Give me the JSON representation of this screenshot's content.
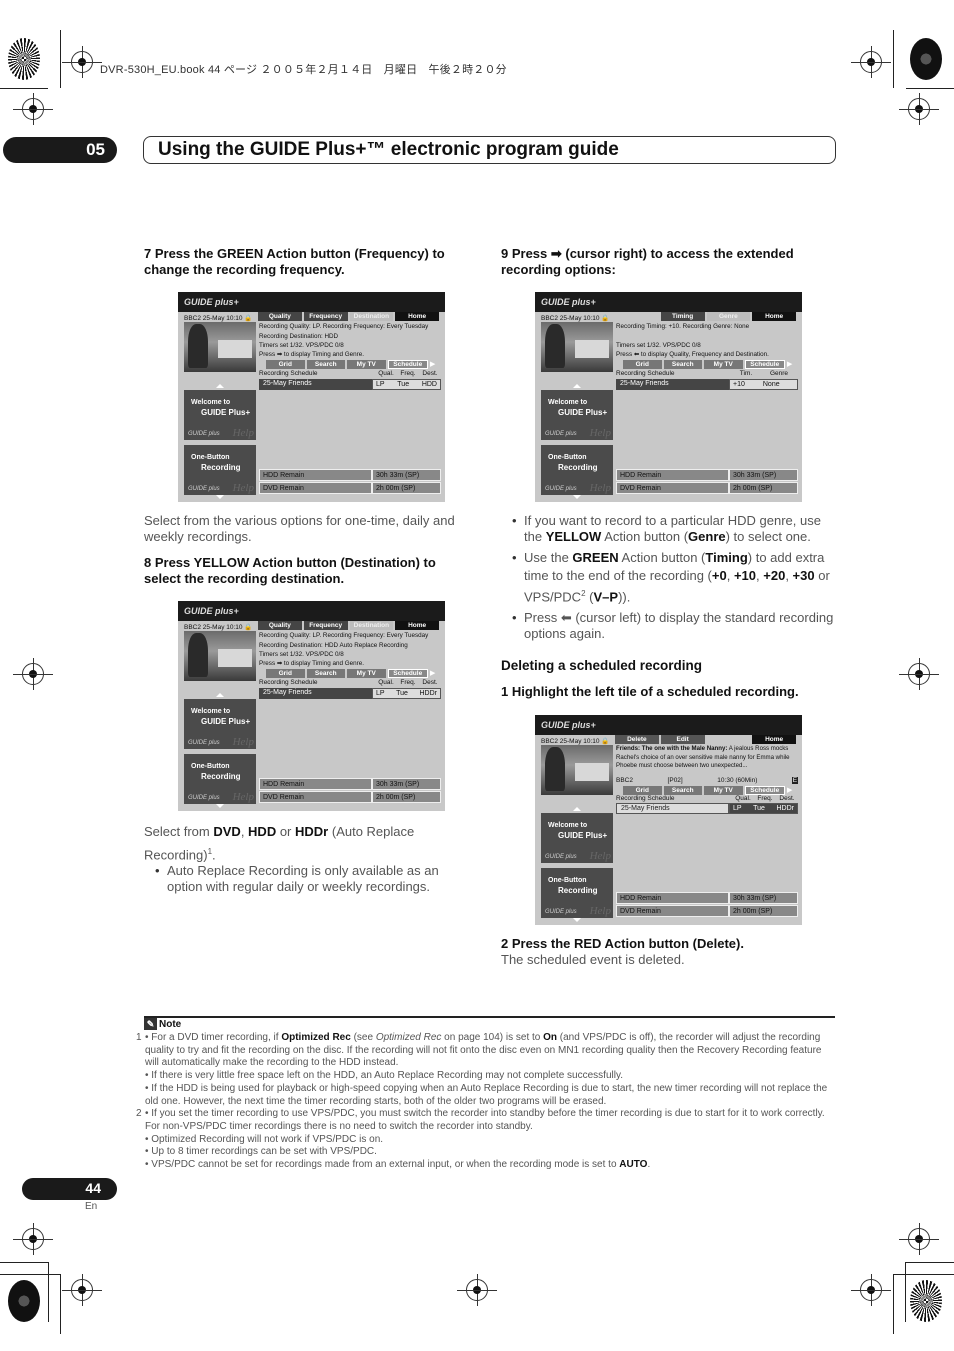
{
  "file_header": "DVR-530H_EU.book  44 ページ  ２００５年２月１４日　月曜日　午後２時２０分",
  "chapter": {
    "number": "05",
    "title": "Using the GUIDE Plus+™ electronic program guide"
  },
  "left_column": {
    "step7": "7    Press the GREEN Action button (Frequency) to change the recording frequency.",
    "step7_text": "Select from the various options for one-time, daily and weekly recordings.",
    "step8": "8    Press YELLOW Action button (Destination) to select the recording destination.",
    "step8_text": {
      "prefix": "Select from ",
      "opt1": "DVD",
      "sep1": ", ",
      "opt2": "HDD",
      "sep2": " or ",
      "opt3": "HDDr",
      "suffix": " (Auto Replace Recording)",
      "footnote_ref": "1",
      "end": "."
    },
    "step8_bullets": [
      "Auto Replace Recording is only available as an option with regular daily or weekly recordings."
    ]
  },
  "right_column": {
    "step9": "9    Press ➡ (cursor right) to access the extended recording options:",
    "bullets": [
      {
        "a": "If you want to record to a particular HDD genre, use the ",
        "b1": "YELLOW",
        "c": " Action button (",
        "b2": "Genre",
        "d": ") to select one."
      },
      {
        "a": "Use the ",
        "b1": "GREEN",
        "c": " Action button (",
        "b2": "Timing",
        "d": ") to add extra time to the end of the recording (",
        "v1": "+0",
        "v2": "+10",
        "v3": "+20",
        "v4": "+30",
        "e": " or VPS/PDC",
        "sup": "2",
        "f": " (",
        "v5": "V–P",
        "g": "))."
      },
      {
        "a": "Press ⬅ (cursor left) to display the standard recording options again."
      }
    ],
    "section_title": "Deleting a scheduled recording",
    "step1": "1    Highlight the left tile of a scheduled recording.",
    "step2": "2    Press the RED Action button (Delete).",
    "step2_text": "The scheduled event is deleted."
  },
  "screens": {
    "common": {
      "logo": "GUIDE plus+",
      "channel_info": "BBC2   25-May  10:10  🔒",
      "nav": [
        "Grid",
        "Search",
        "My TV",
        "Schedule"
      ],
      "schedule_label": "Recording Schedule",
      "schedule_title": "25-May  Friends",
      "tile1_line1": "Welcome to",
      "tile1_line2": "GUIDE Plus+",
      "tile2_line1": "One-Button",
      "tile2_line2": "Recording",
      "tile_mini_logo": "GUIDE plus",
      "tile_help": "Help",
      "hdd_remain_label": "HDD Remain",
      "hdd_remain_value": "30h 33m (SP)",
      "dvd_remain_label": "DVD Remain",
      "dvd_remain_value": "2h 00m (SP)"
    },
    "screen1": {
      "tabs": [
        "Quality",
        "Frequency",
        "Destination",
        "Home"
      ],
      "info": [
        "Recording Quality: LP. Recording Frequency: Every Tuesday",
        "Recording Destination: HDD",
        "Timers set 1/32. VPS/PDC 0/8",
        "Press ➡ to display Timing and Genre."
      ],
      "cols": [
        "Qual.",
        "Freq.",
        "Dest."
      ],
      "vals": [
        "LP",
        "Tue",
        "HDD"
      ]
    },
    "screen2": {
      "tabs": [
        "Quality",
        "Frequency",
        "Destination",
        "Home"
      ],
      "info": [
        "Recording Quality: LP. Recording Frequency: Every Tuesday",
        "Recording Destination: HDD Auto Replace Recording",
        "Timers set 1/32. VPS/PDC 0/8",
        "Press ➡ to display Timing and Genre."
      ],
      "cols": [
        "Qual.",
        "Freq.",
        "Dest."
      ],
      "vals": [
        "LP",
        "Tue",
        "HDDr"
      ]
    },
    "screen3": {
      "tabs": [
        "Timing",
        "Genre",
        "Home"
      ],
      "info": [
        "Recording Timing: +10. Recording Genre: None",
        "",
        "Timers set 1/32. VPS/PDC 0/8",
        "Press ⬅ to display Quality, Frequency and Destination."
      ],
      "cols": [
        "Tim.",
        "Genre"
      ],
      "vals": [
        "+10",
        "None"
      ]
    },
    "screen4": {
      "tabs": [
        "Delete",
        "Edit",
        "Home"
      ],
      "info_bold": "Friends: The one with the Male Nanny:",
      "info": " A jealous Ross mocks Rachel's choice of an over sensitive male nanny for Emma while Phoebe must choose between two unexpected...",
      "ext": [
        "BBC2",
        "[P02]",
        "10:30 (60Min)",
        "E"
      ],
      "cols": [
        "Qual.",
        "Freq.",
        "Dest."
      ],
      "vals": [
        "LP",
        "Tue",
        "HDDr"
      ]
    }
  },
  "note": {
    "heading": "Note",
    "fn1": {
      "num": "1",
      "p1": {
        "a": "• For a DVD timer recording, if ",
        "b": "Optimized Rec",
        "c": " (see ",
        "i": "Optimized Rec",
        "d": " on page 104) is set to ",
        "b2": "On",
        "e": " (and VPS/PDC is off), the recorder will adjust the recording quality to try and fit the recording on the disc. If the recording will not fit onto the disc even on MN1 recording quality then the Recovery Recording feature will automatically make the recording to the HDD instead."
      },
      "p2": "• If there is very little free space left on the HDD, an Auto Replace Recording may not complete successfully.",
      "p3": "• If the HDD is being used for playback or high-speed copying when an Auto Replace Recording is due to start, the new timer recording will not replace the old one. However, the next time the timer recording starts, both of the older two programs will be erased."
    },
    "fn2": {
      "num": "2",
      "p1": "• If you set the timer recording to use VPS/PDC, you must switch the recorder into standby before the timer recording is due to start for it to work correctly. For non-VPS/PDC timer recordings there is no need to switch the recorder into standby.",
      "p2": "• Optimized Recording will not work if VPS/PDC is on.",
      "p3": "• Up to 8 timer recordings can be set with VPS/PDC.",
      "p4a": "• VPS/PDC cannot be set for recordings made from an external input, or when the recording mode is set to ",
      "p4b": "AUTO",
      "p4c": "."
    }
  },
  "footer": {
    "page_number": "44",
    "language": "En"
  }
}
